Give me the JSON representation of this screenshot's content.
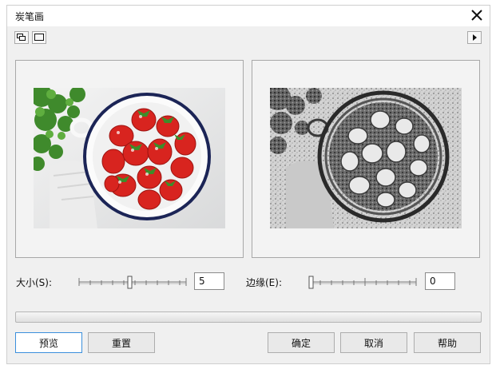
{
  "window": {
    "title": "炭笔画"
  },
  "toolbar": {
    "split_view_icon": "dual-preview-icon",
    "single_view_icon": "single-preview-icon",
    "expand_icon": "triangle-right-icon"
  },
  "controls": {
    "size": {
      "label": "大小(S):",
      "value": "5",
      "level": 0.45
    },
    "edge": {
      "label": "边缘(E):",
      "value": "0",
      "level": 0.0
    }
  },
  "progress": {
    "level": 0
  },
  "buttons": {
    "preview": "预览",
    "reset": "重置",
    "ok": "确定",
    "cancel": "取消",
    "help": "帮助"
  },
  "colors": {
    "accent": "#3b8fdc",
    "strawberry": "#d8241f",
    "bowl_rim": "#1b2456"
  }
}
